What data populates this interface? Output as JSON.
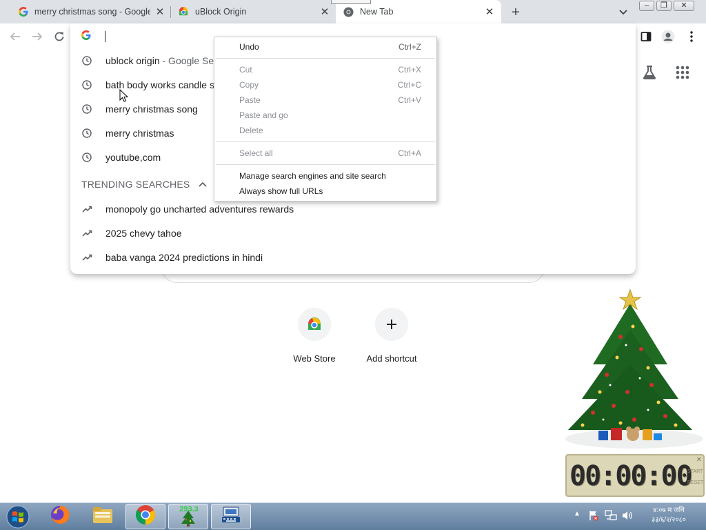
{
  "tabs": [
    {
      "title": "merry christmas song - Google S",
      "favicon": "google-icon",
      "active": false
    },
    {
      "title": "uBlock Origin",
      "favicon": "webstore-icon",
      "active": false
    },
    {
      "title": "New Tab",
      "favicon": "chrome-icon",
      "active": true
    }
  ],
  "omnibox": {
    "value": "",
    "search_engine_icon": "google-icon",
    "suggestions": [
      {
        "text": "ublock origin",
        "subtext": " - Google Se",
        "icon": "history-icon"
      },
      {
        "text": "bath body works candle s",
        "subtext": "",
        "icon": "history-icon"
      },
      {
        "text": "merry christmas song",
        "subtext": "",
        "icon": "history-icon"
      },
      {
        "text": "merry christmas",
        "subtext": "",
        "icon": "history-icon"
      },
      {
        "text": "youtube,com",
        "subtext": "",
        "icon": "history-icon"
      }
    ],
    "trending_header": "TRENDING SEARCHES",
    "trending": [
      {
        "text": "monopoly go uncharted adventures rewards",
        "icon": "trending-icon"
      },
      {
        "text": "2025 chevy tahoe",
        "icon": "trending-icon"
      },
      {
        "text": "baba vanga 2024 predictions in hindi",
        "icon": "trending-icon"
      }
    ]
  },
  "context_menu": {
    "items": [
      {
        "label": "Undo",
        "shortcut": "Ctrl+Z",
        "enabled": true
      },
      {
        "label": "Cut",
        "shortcut": "Ctrl+X",
        "enabled": false
      },
      {
        "label": "Copy",
        "shortcut": "Ctrl+C",
        "enabled": false
      },
      {
        "label": "Paste",
        "shortcut": "Ctrl+V",
        "enabled": false
      },
      {
        "label": "Paste and go",
        "shortcut": "",
        "enabled": false
      },
      {
        "label": "Delete",
        "shortcut": "",
        "enabled": false
      },
      {
        "label": "Select all",
        "shortcut": "Ctrl+A",
        "enabled": false
      },
      {
        "label": "Manage search engines and site search",
        "shortcut": "",
        "enabled": true
      },
      {
        "label": "Always show full URLs",
        "shortcut": "",
        "enabled": true
      }
    ]
  },
  "shortcuts": [
    {
      "label": "Web Store",
      "icon": "webstore-icon"
    },
    {
      "label": "Add shortcut",
      "icon": "plus-icon"
    }
  ],
  "timer": {
    "display": "00:00:00",
    "start_label": "START",
    "reset_label": "RESET"
  },
  "taskbar": {
    "apps": [
      "firefox-icon",
      "file-explorer-icon",
      "chrome-icon",
      "christmas-tree-app-icon",
      "keyboard-app-icon"
    ],
    "tree_badge": "293.3",
    "clock_line1": "४:०७ म जनि",
    "clock_line2": "३३/६/२/२०८०"
  },
  "colors": {
    "accent": "#1a73e8",
    "tabstrip": "#dee1e6",
    "taskbar": "#6f8cab"
  }
}
